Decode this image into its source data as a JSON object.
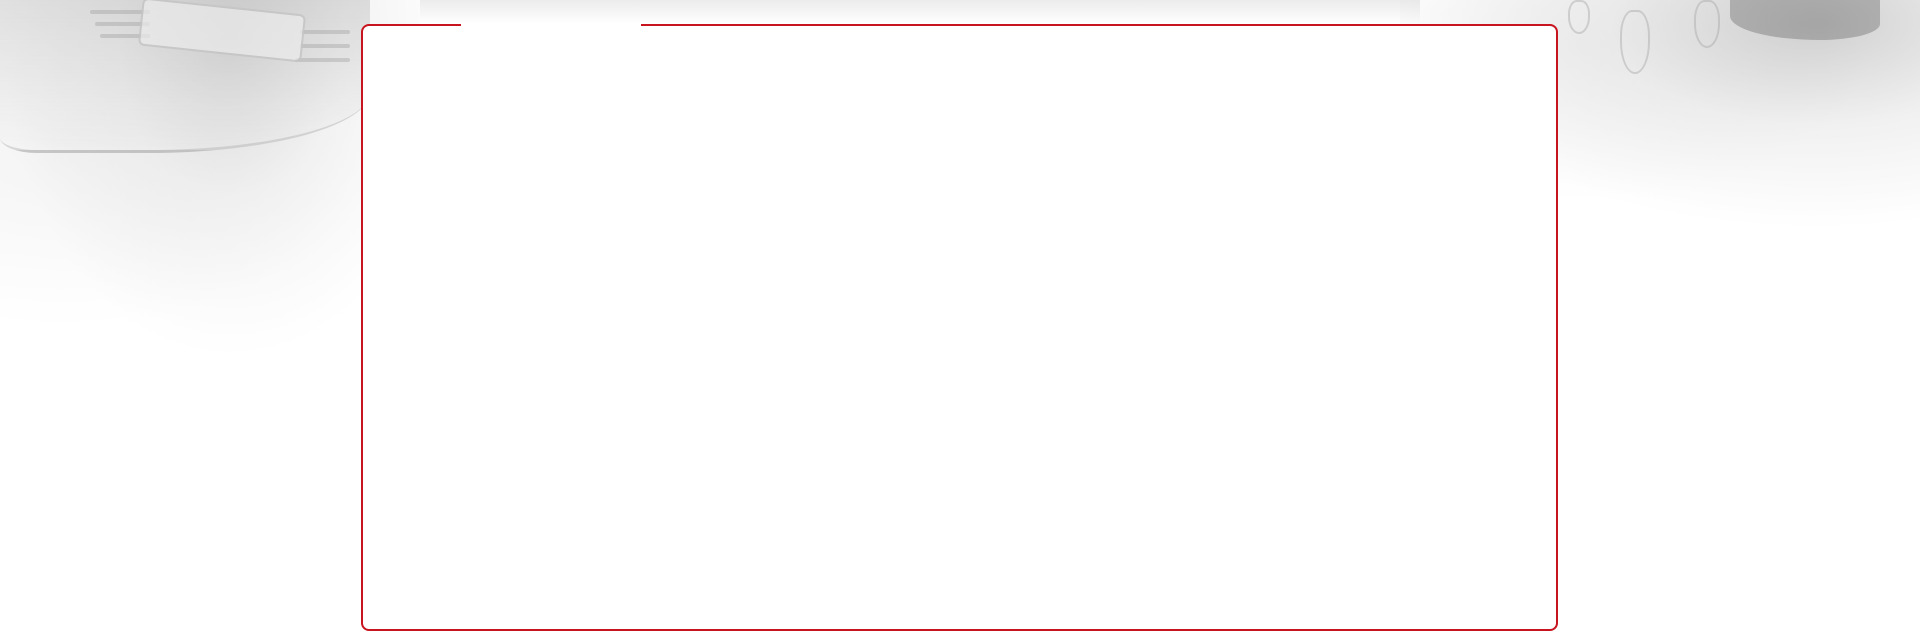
{
  "page": {
    "background_color": "#ffffff"
  },
  "panel": {
    "border_color": "#c8141e",
    "title": ""
  },
  "background": {
    "left_image": "car-front-photo",
    "right_image": "dining-scene-photo",
    "image_tone": "faded-grayscale"
  }
}
